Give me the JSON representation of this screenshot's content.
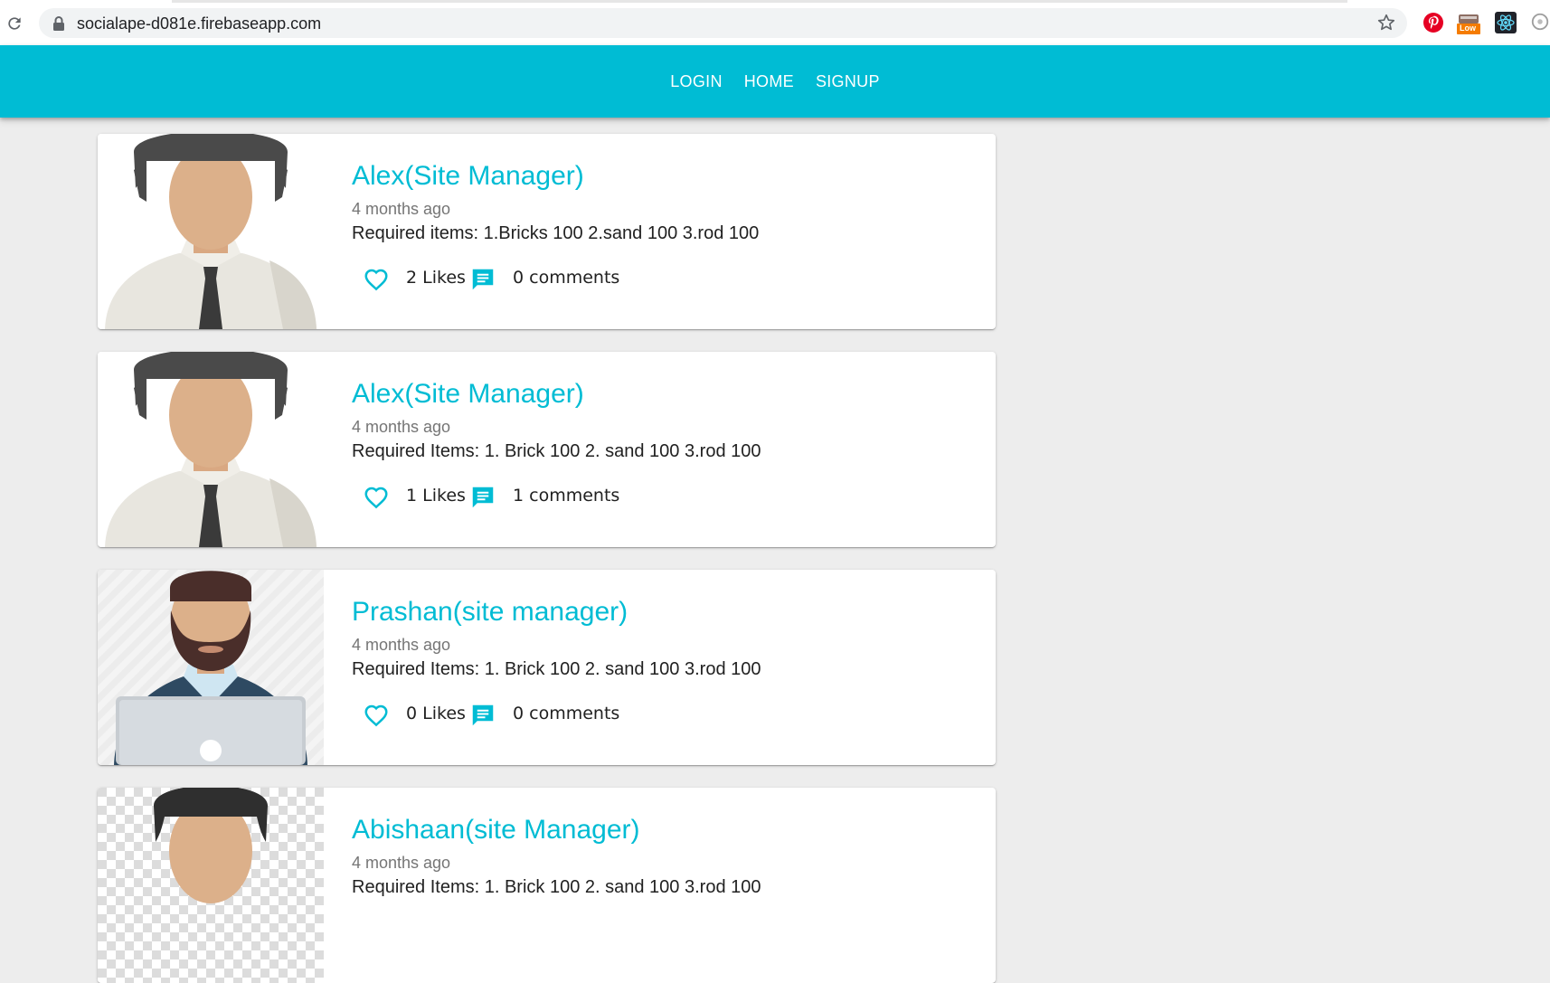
{
  "browser": {
    "url": "socialape-d081e.firebaseapp.com",
    "extensions": [
      "pinterest-icon",
      "low-badge-icon",
      "react-devtools-icon",
      "extension-icon"
    ],
    "low_badge": "Low"
  },
  "nav": {
    "links": [
      "LOGIN",
      "HOME",
      "SIGNUP"
    ]
  },
  "colors": {
    "primary": "#00bcd4",
    "background": "#ededed"
  },
  "posts": [
    {
      "user": "Alex(Site Manager)",
      "time": "4 months ago",
      "body": "Required items: 1.Bricks 100 2.sand 100 3.rod 100",
      "likes": "2 Likes",
      "comments": "0 comments",
      "avatar": "man-with-tie"
    },
    {
      "user": "Alex(Site Manager)",
      "time": "4 months ago",
      "body": "Required Items: 1. Brick 100 2. sand 100 3.rod 100",
      "likes": "1 Likes",
      "comments": "1 comments",
      "avatar": "man-with-tie"
    },
    {
      "user": "Prashan(site manager)",
      "time": "4 months ago",
      "body": "Required Items: 1. Brick 100 2. sand 100 3.rod 100",
      "likes": "0 Likes",
      "comments": "0 comments",
      "avatar": "bearded-man-with-laptop"
    },
    {
      "user": "Abishaan(site Manager)",
      "time": "4 months ago",
      "body": "Required Items: 1. Brick 100 2. sand 100 3.rod 100",
      "avatar": "man-on-transparent"
    }
  ]
}
